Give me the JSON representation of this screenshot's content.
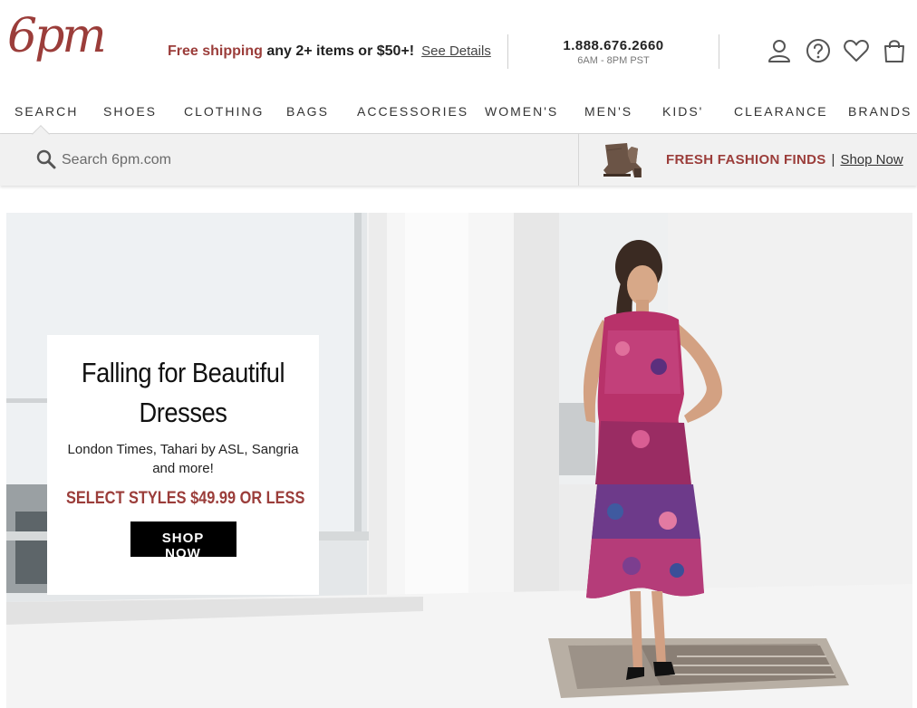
{
  "header": {
    "logo_text": "6pm",
    "promo": {
      "highlight": "Free shipping",
      "rest": " any 2+ items or $50+!",
      "link": "See Details"
    },
    "phone": {
      "number": "1.888.676.2660",
      "hours": "6AM - 8PM PST"
    },
    "icons": [
      "account-icon",
      "help-icon",
      "heart-icon",
      "shopping-bag-icon"
    ]
  },
  "nav": {
    "items": [
      {
        "label": "SEARCH"
      },
      {
        "label": "SHOES"
      },
      {
        "label": "CLOTHING"
      },
      {
        "label": "BAGS"
      },
      {
        "label": "ACCESSORIES"
      },
      {
        "label": "WOMEN'S"
      },
      {
        "label": "MEN'S"
      },
      {
        "label": "KIDS'"
      },
      {
        "label": "CLEARANCE"
      },
      {
        "label": "BRANDS"
      }
    ]
  },
  "search": {
    "placeholder": "Search 6pm.com",
    "value": ""
  },
  "fresh_finds": {
    "title": "FRESH FASHION FINDS",
    "separator": "|",
    "link": "Shop Now"
  },
  "hero": {
    "title_line1": "Falling for Beautiful",
    "title_line2": "Dresses",
    "subtitle": "London Times, Tahari by ASL, Sangria and more!",
    "offer": "SELECT STYLES $49.99 OR LESS",
    "button": "SHOP NOW"
  },
  "colors": {
    "brand": "#9b3d3a",
    "nav_text": "#333333",
    "search_bg": "#f1f1f1",
    "button_bg": "#000000"
  }
}
